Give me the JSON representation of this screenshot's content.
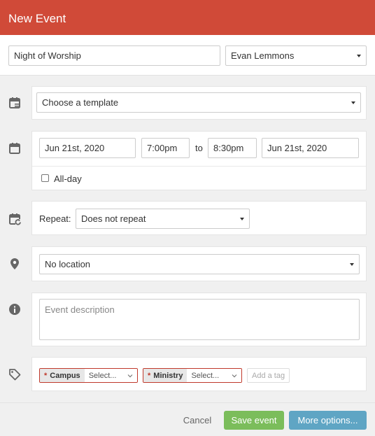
{
  "header": {
    "title": "New Event"
  },
  "event": {
    "name": "Night of Worship",
    "owner": "Evan Lemmons"
  },
  "template": {
    "placeholder": "Choose a template"
  },
  "datetime": {
    "start_date": "Jun 21st, 2020",
    "start_time": "7:00pm",
    "to_label": "to",
    "end_time": "8:30pm",
    "end_date": "Jun 21st, 2020",
    "all_day_label": "All-day",
    "all_day_checked": false
  },
  "repeat": {
    "label": "Repeat:",
    "value": "Does not repeat"
  },
  "location": {
    "value": "No location"
  },
  "description": {
    "placeholder": "Event description"
  },
  "tags": {
    "pickers": [
      {
        "required_mark": "*",
        "name": "Campus",
        "value": "Select..."
      },
      {
        "required_mark": "*",
        "name": "Ministry",
        "value": "Select..."
      }
    ],
    "add_placeholder": "Add a tag"
  },
  "footer": {
    "cancel_label": "Cancel",
    "save_label": "Save event",
    "more_label": "More options...",
    "colors": {
      "header": "#d04a38",
      "save": "#7bbd5b",
      "more": "#5fa5c4",
      "required": "#c0392b"
    }
  },
  "icons": [
    "calendar-template-icon",
    "calendar-icon",
    "calendar-repeat-icon",
    "location-pin-icon",
    "info-icon",
    "tag-icon",
    "chevron-down-icon"
  ]
}
